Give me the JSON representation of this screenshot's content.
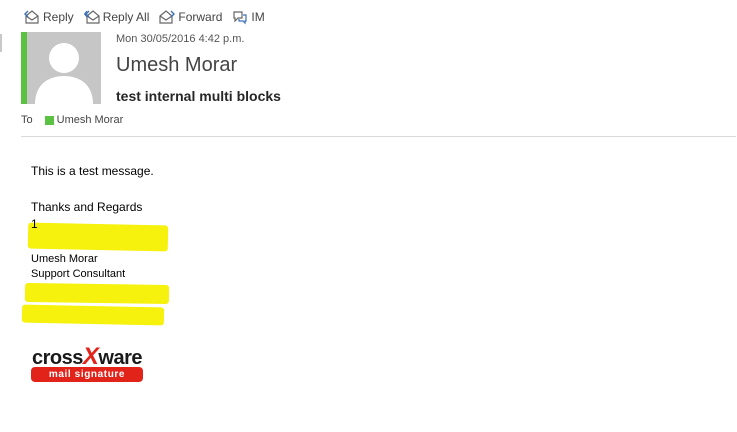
{
  "toolbar": {
    "reply": "Reply",
    "reply_all": "Reply All",
    "forward": "Forward",
    "im": "IM"
  },
  "header": {
    "date": "Mon 30/05/2016 4:42 p.m.",
    "sender": "Umesh Morar",
    "subject": "test internal multi blocks",
    "to_label": "To",
    "recipient": "Umesh Morar"
  },
  "body": {
    "line1": "This is a test message.",
    "regards": "Thanks and Regards",
    "number": "1",
    "sig_name": "Umesh Morar",
    "sig_title": "Support Consultant"
  },
  "logo": {
    "word_left": "cross",
    "word_x": "X",
    "word_right": "ware",
    "tagline": "mail signature"
  },
  "colors": {
    "accent_green": "#5ac143",
    "highlight_yellow": "#f6f000",
    "logo_red": "#e2231a"
  }
}
